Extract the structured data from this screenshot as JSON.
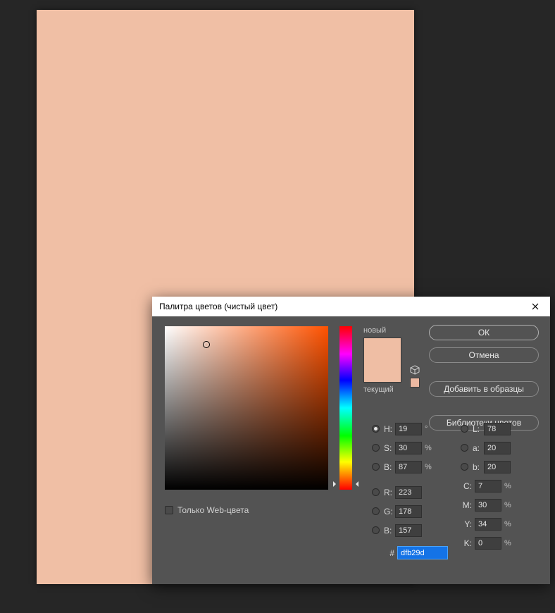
{
  "canvas": {
    "fill": "#f0bfa5"
  },
  "dialog": {
    "title": "Палитра цветов (чистый цвет)",
    "buttons": {
      "ok": "ОК",
      "cancel": "Отмена",
      "add": "Добавить в образцы",
      "libs": "Библиотеки цветов"
    },
    "swatch": {
      "new_label": "новый",
      "current_label": "текущий"
    },
    "webonly_label": "Только Web-цвета",
    "hsb": {
      "h_label": "H:",
      "s_label": "S:",
      "b_label": "B:",
      "h": "19",
      "s": "30",
      "b": "87",
      "h_unit": "°",
      "pct": "%"
    },
    "lab": {
      "l_label": "L:",
      "a_label": "a:",
      "b_label": "b:",
      "l": "78",
      "a": "20",
      "b": "20"
    },
    "rgb": {
      "r_label": "R:",
      "g_label": "G:",
      "b_label": "B:",
      "r": "223",
      "g": "178",
      "b": "157"
    },
    "cmyk": {
      "c_label": "C:",
      "m_label": "M:",
      "y_label": "Y:",
      "k_label": "K:",
      "c": "7",
      "m": "30",
      "y": "34",
      "k": "0",
      "pct": "%"
    },
    "hex": {
      "hash": "#",
      "value": "dfb29d"
    }
  }
}
